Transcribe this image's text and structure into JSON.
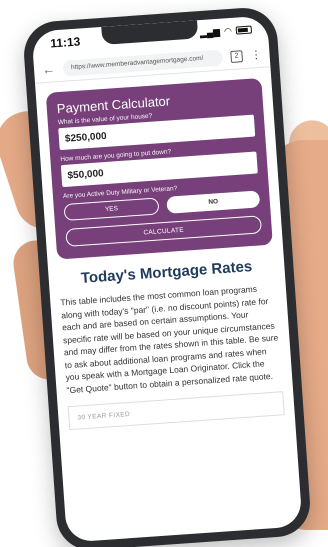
{
  "status_bar": {
    "time": "11:13"
  },
  "browser": {
    "url": "https://www.memberadvantagemortgage.com/",
    "tab_count": "2"
  },
  "calculator": {
    "title": "Payment Calculator",
    "house_value_question": "What is the value of your house?",
    "house_value": "$250,000",
    "down_payment_question": "How much are you going to put down?",
    "down_payment": "$50,000",
    "military_question": "Are you Active Duty Military or Veteran?",
    "yes_label": "YES",
    "no_label": "NO",
    "calculate_label": "CALCULATE"
  },
  "rates": {
    "heading": "Today's Mortgage Rates",
    "description": "This table includes the most common loan programs along with today's \"par\" (i.e. no discount points) rate for each and are based on certain assumptions. Your specific rate will be based on your unique circumstances and may differ from the rates shown in this table. Be sure to ask about additional loan programs and rates when you speak with a Mortgage Loan Originator. Click the \"Get Quote\" button to obtain a personalized rate quote.",
    "first_program": "30 YEAR FIXED"
  },
  "colors": {
    "calculator_bg": "#77407a",
    "heading": "#1f3b5c"
  }
}
